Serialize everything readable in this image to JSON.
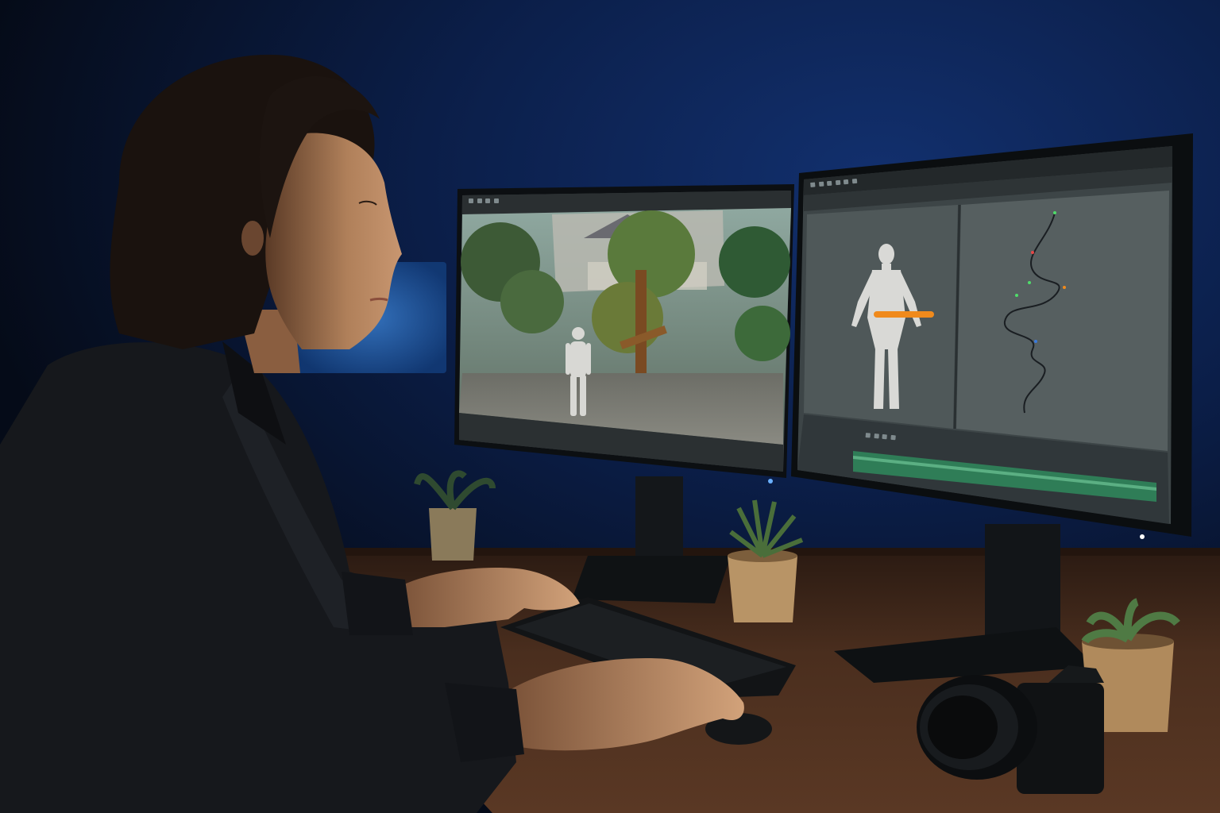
{
  "scene": {
    "description_alt": "",
    "left_monitor": {
      "menu_items": [
        "",
        "",
        "",
        ""
      ],
      "viewport": "3d-park-scene"
    },
    "right_monitor": {
      "menu_items": [
        "",
        "",
        "",
        ""
      ],
      "viewport_left": "character-rig",
      "viewport_right": "motion-trajectory",
      "timeline": "animation-timeline"
    }
  },
  "colors": {
    "wall": "#0a1a3a",
    "desk": "#3a2418",
    "accent_orange": "#f08a1c",
    "timeline_green": "#2f8f5f",
    "screen_gray": "#4c5556"
  }
}
